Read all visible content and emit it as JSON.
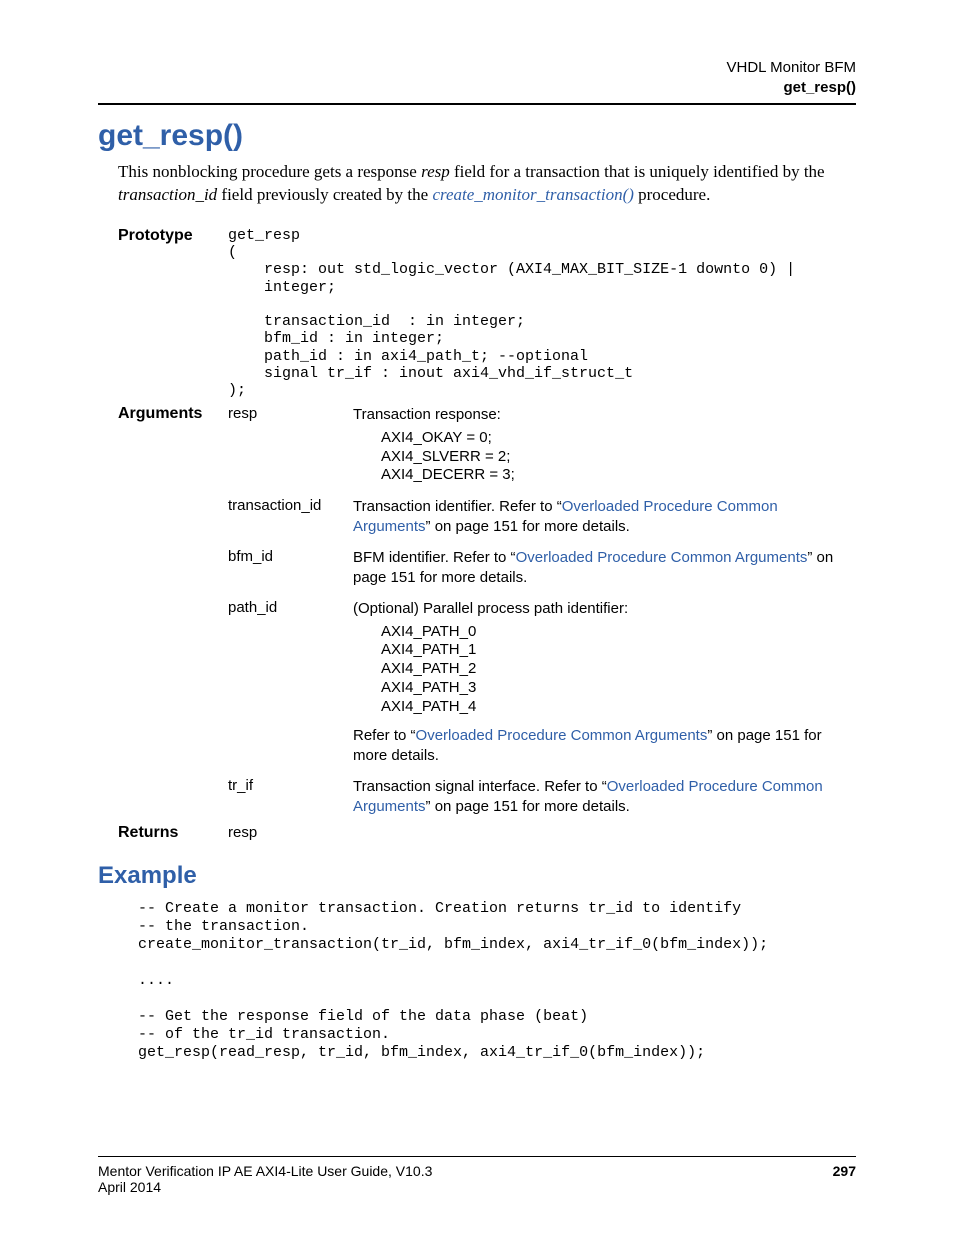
{
  "header": {
    "chapter": "VHDL Monitor BFM",
    "section": "get_resp()"
  },
  "title": "get_resp()",
  "intro": {
    "pre1": "This nonblocking procedure gets a response ",
    "resp_italic": "resp",
    "mid1": " field for a transaction that is uniquely identified by the ",
    "tid_italic": "transaction_id",
    "mid2": " field previously created by the ",
    "link_text": "create_monitor_transaction()",
    "post": " procedure."
  },
  "labels": {
    "prototype": "Prototype",
    "arguments": "Arguments",
    "returns": "Returns"
  },
  "prototype_code": "get_resp\n(\n    resp: out std_logic_vector (AXI4_MAX_BIT_SIZE-1 downto 0) |\n    integer;\n\n    transaction_id  : in integer;\n    bfm_id : in integer;\n    path_id : in axi4_path_t; --optional\n    signal tr_if : inout axi4_vhd_if_struct_t\n);",
  "args": {
    "resp": {
      "name": "resp",
      "desc": "Transaction response:",
      "values": "AXI4_OKAY = 0;\nAXI4_SLVERR = 2;\nAXI4_DECERR = 3;"
    },
    "transaction_id": {
      "name": "transaction_id",
      "pre": "Transaction identifier. Refer to “",
      "link": "Overloaded Procedure Common Arguments",
      "post": "” on page 151 for more details."
    },
    "bfm_id": {
      "name": "bfm_id",
      "pre": "BFM identifier. Refer to “",
      "link": "Overloaded Procedure Common Arguments",
      "post": "” on page 151 for more details."
    },
    "path_id": {
      "name": "path_id",
      "desc": "(Optional) Parallel process path identifier:",
      "values": "AXI4_PATH_0\nAXI4_PATH_1\nAXI4_PATH_2\nAXI4_PATH_3\nAXI4_PATH_4",
      "post_pre": "Refer to “",
      "post_link": "Overloaded Procedure Common Arguments",
      "post_post": "” on page 151 for more details."
    },
    "tr_if": {
      "name": "tr_if",
      "pre": "Transaction signal interface. Refer to “",
      "link": "Overloaded Procedure Common Arguments",
      "post": "” on page 151 for more details."
    }
  },
  "returns_value": "resp",
  "example_heading": "Example",
  "example_code": "-- Create a monitor transaction. Creation returns tr_id to identify\n-- the transaction.\ncreate_monitor_transaction(tr_id, bfm_index, axi4_tr_if_0(bfm_index));\n\n....\n\n-- Get the response field of the data phase (beat)\n-- of the tr_id transaction.\nget_resp(read_resp, tr_id, bfm_index, axi4_tr_if_0(bfm_index));",
  "footer": {
    "doc_title": "Mentor Verification IP AE AXI4-Lite User Guide, V10.3",
    "date": "April 2014",
    "page": "297"
  }
}
